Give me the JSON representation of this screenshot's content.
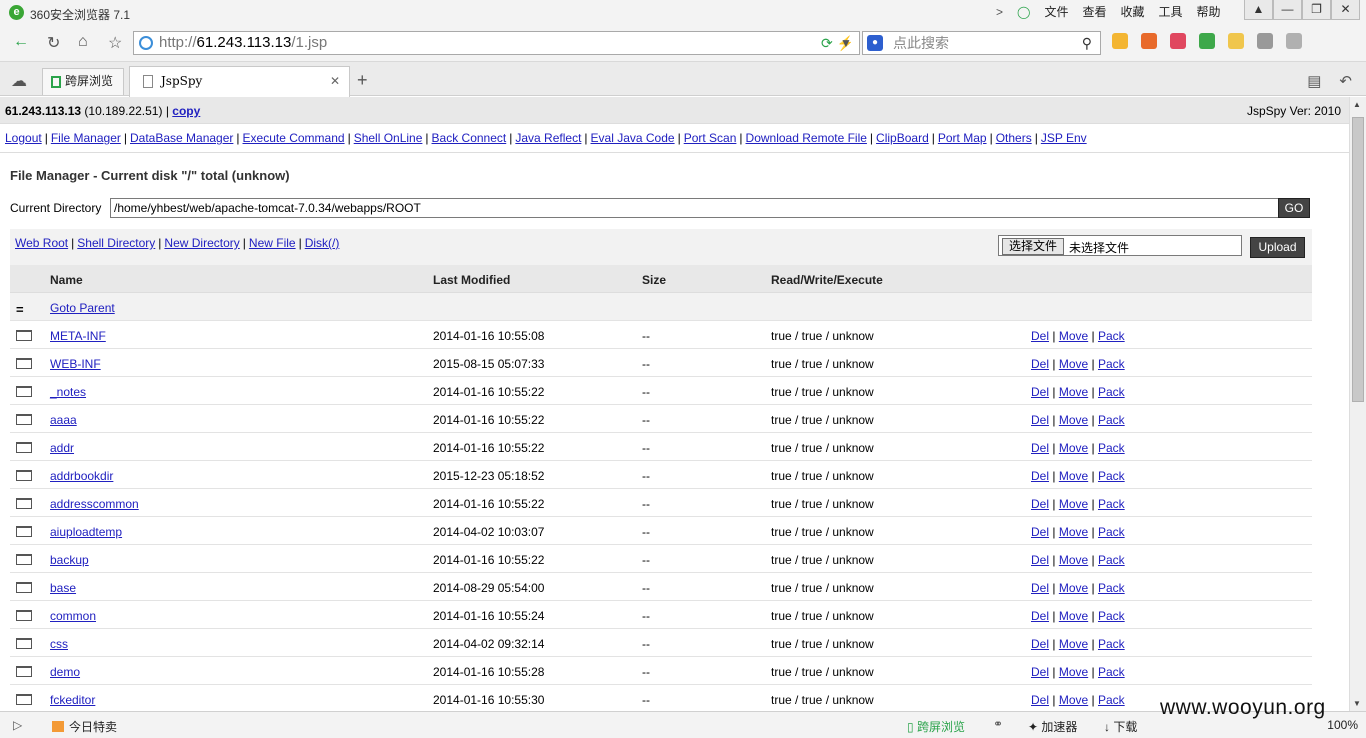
{
  "browser": {
    "title": "360安全浏览器 7.1",
    "menu": [
      "文件",
      "查看",
      "收藏",
      "工具",
      "帮助"
    ],
    "url_scheme": "http://",
    "url_host": "61.243.113.13",
    "url_path": "/1.jsp",
    "search_placeholder": "点此搜索",
    "tabs": {
      "split_label": "跨屏浏览",
      "active_label": "JspSpy"
    },
    "status": {
      "left_label": "今日特卖",
      "split_label": "跨屏浏览",
      "accel_label": "加速器",
      "download_label": "下载",
      "zoom": "100%"
    },
    "watermark": "www.wooyun.org"
  },
  "page": {
    "host_ip": "61.243.113.13",
    "local_ip": "(10.189.22.51)",
    "sep": "|",
    "copy_label": "copy",
    "version": "JspSpy Ver: 2010",
    "nav": [
      "Logout",
      "File Manager",
      "DataBase Manager",
      "Execute Command",
      "Shell OnLine",
      "Back Connect",
      "Java Reflect",
      "Eval Java Code",
      "Port Scan",
      "Download Remote File",
      "ClipBoard",
      "Port Map",
      "Others",
      "JSP Env"
    ],
    "heading": "File Manager - Current disk \"/\" total (unknow)",
    "current_dir_label": "Current Directory",
    "current_dir_value": "/home/yhbest/web/apache-tomcat-7.0.34/webapps/ROOT",
    "go_label": "GO",
    "tools": [
      "Web Root",
      "Shell Directory",
      "New Directory",
      "New File",
      "Disk(/)"
    ],
    "choose_file_label": "选择文件",
    "no_file_label": "未选择文件",
    "upload_label": "Upload",
    "columns": [
      "Name",
      "Last Modified",
      "Size",
      "Read/Write/Execute"
    ],
    "parent_label": "Goto Parent",
    "actions": [
      "Del",
      "Move",
      "Pack"
    ],
    "rows": [
      {
        "name": "META-INF",
        "modified": "2014-01-16 10:55:08",
        "size": "--",
        "perm": "true / true / unknow"
      },
      {
        "name": "WEB-INF",
        "modified": "2015-08-15 05:07:33",
        "size": "--",
        "perm": "true / true / unknow"
      },
      {
        "name": "_notes",
        "modified": "2014-01-16 10:55:22",
        "size": "--",
        "perm": "true / true / unknow"
      },
      {
        "name": "aaaa",
        "modified": "2014-01-16 10:55:22",
        "size": "--",
        "perm": "true / true / unknow"
      },
      {
        "name": "addr",
        "modified": "2014-01-16 10:55:22",
        "size": "--",
        "perm": "true / true / unknow"
      },
      {
        "name": "addrbookdir",
        "modified": "2015-12-23 05:18:52",
        "size": "--",
        "perm": "true / true / unknow"
      },
      {
        "name": "addresscommon",
        "modified": "2014-01-16 10:55:22",
        "size": "--",
        "perm": "true / true / unknow"
      },
      {
        "name": "aiuploadtemp",
        "modified": "2014-04-02 10:03:07",
        "size": "--",
        "perm": "true / true / unknow"
      },
      {
        "name": "backup",
        "modified": "2014-01-16 10:55:22",
        "size": "--",
        "perm": "true / true / unknow"
      },
      {
        "name": "base",
        "modified": "2014-08-29 05:54:00",
        "size": "--",
        "perm": "true / true / unknow"
      },
      {
        "name": "common",
        "modified": "2014-01-16 10:55:24",
        "size": "--",
        "perm": "true / true / unknow"
      },
      {
        "name": "css",
        "modified": "2014-04-02 09:32:14",
        "size": "--",
        "perm": "true / true / unknow"
      },
      {
        "name": "demo",
        "modified": "2014-01-16 10:55:28",
        "size": "--",
        "perm": "true / true / unknow"
      },
      {
        "name": "fckeditor",
        "modified": "2014-01-16 10:55:30",
        "size": "--",
        "perm": "true / true / unknow"
      }
    ]
  }
}
